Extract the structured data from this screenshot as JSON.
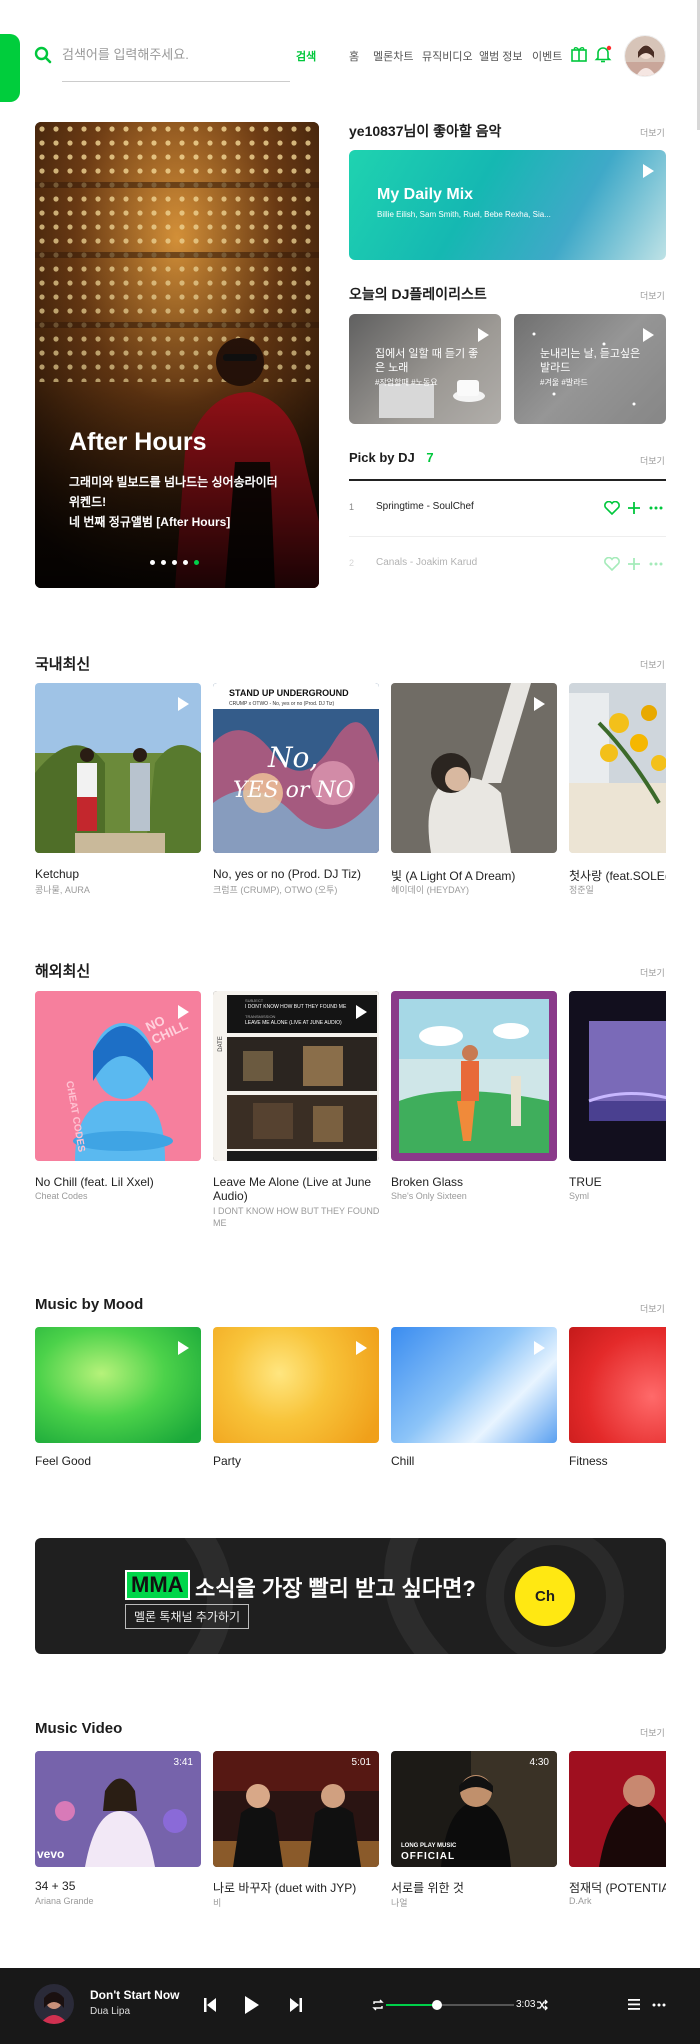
{
  "header": {
    "search_placeholder": "검색어를 입력해주세요.",
    "search_button": "검색",
    "nav": [
      "홈",
      "멜론차트",
      "뮤직비디오",
      "앨범 정보",
      "이벤트"
    ]
  },
  "banner": {
    "title": "After Hours",
    "line1": "그래미와 빌보드를 넘나드는 싱어송라이터",
    "line2": "위켄드!",
    "line3": "네 번째 정규앨범 [After Hours]"
  },
  "recommend": {
    "title": "ye10837님이 좋아할 음악",
    "more": "더보기",
    "mix_title": "My Daily Mix",
    "mix_artists": "Billie Eilish, Sam Smith, Ruel, Bebe Rexha, Sia..."
  },
  "dj_playlists": {
    "title": "오늘의 DJ플레이리스트",
    "more": "더보기",
    "items": [
      {
        "line1": "집에서 일할 때 듣기 좋",
        "line2": "은 노래",
        "tags": "#작업할때 #노동요"
      },
      {
        "line1": "눈내리는 날, 듣고싶은",
        "line2": "발라드",
        "tags": "#겨울 #발라드"
      }
    ]
  },
  "pick": {
    "title": "Pick by DJ",
    "count": "7",
    "more": "더보기",
    "rows": [
      {
        "num": "1",
        "track": "Springtime - SoulChef"
      },
      {
        "num": "2",
        "track": "Canals - Joakim Karud"
      }
    ]
  },
  "domestic": {
    "title": "국내최신",
    "more": "더보기",
    "items": [
      {
        "title": "Ketchup",
        "artist": "콩나물, AURA"
      },
      {
        "title": "No, yes or no (Prod. DJ Tiz)",
        "artist": "크럼프 (CRUMP), OTWO (오투)"
      },
      {
        "title": "빛 (A Light Of A Dream)",
        "artist": "헤이데이 (HEYDAY)"
      },
      {
        "title": "첫사랑 (feat.SOLE(쏠))",
        "artist": "정준일"
      }
    ],
    "album_text": {
      "header": "STAND UP UNDERGROUND",
      "sub": "CRUMP x OTWO - No, yes or no (Prod. DJ Tiz)",
      "graffiti1": "No,",
      "graffiti2": "YES or NO"
    }
  },
  "overseas": {
    "title": "해외최신",
    "more": "더보기",
    "items": [
      {
        "title": "No Chill (feat. Lil Xxel)",
        "artist": "Cheat Codes"
      },
      {
        "title": "Leave Me Alone (Live at June",
        "title2": "Audio)",
        "artist": "I DONT KNOW HOW BUT THEY FOUND",
        "artist2": "ME"
      },
      {
        "title": "Broken Glass",
        "artist": "She's Only Sixteen"
      },
      {
        "title": "TRUE",
        "artist": "Syml"
      }
    ],
    "album_text": {
      "nochill": "NO CHILL",
      "cheat": "CHEAT CODES",
      "subject_label": "SUBJECT",
      "subject": "I DONT KNOW HOW BUT THEY FOUND ME",
      "trans_label": "TRANSMISSION",
      "trans": "LEAVE ME ALONE (LIVE AT JUNE AUDIO)",
      "date": "DATE"
    }
  },
  "mood": {
    "title": "Music by Mood",
    "more": "더보기",
    "items": [
      "Feel Good",
      "Party",
      "Chill",
      "Fitness"
    ]
  },
  "ad": {
    "mma": "MMA",
    "headline": "소식을 가장 빨리 받고 싶다면?",
    "button": "멜론 톡채널 추가하기",
    "ch": "Ch"
  },
  "video": {
    "title": "Music Video",
    "more": "더보기",
    "items": [
      {
        "title": "34 + 35",
        "artist": "Ariana Grande",
        "dur": "3:41",
        "badge": "vevo"
      },
      {
        "title": "나로 바꾸자 (duet with JYP)",
        "artist": "비",
        "dur": "5:01"
      },
      {
        "title": "서로를 위한 것",
        "artist": "나얼",
        "dur": "4:30",
        "badge1": "LONG PLAY MUSIC",
        "badge2": "OFFICIAL"
      },
      {
        "title": "점재덕 (POTENTIAL)",
        "artist": "D.Ark",
        "dur": ""
      }
    ]
  },
  "player": {
    "track": "Don't Start Now",
    "artist": "Dua Lipa",
    "time": "3:03",
    "progress": 0.4
  },
  "colors": {
    "accent": "#00c73c",
    "player_bg": "#181818"
  }
}
